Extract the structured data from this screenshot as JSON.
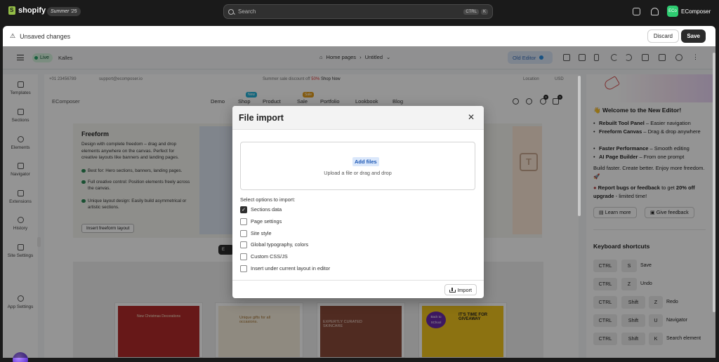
{
  "topbar": {
    "brand": "shopify",
    "edition": "Summer '25",
    "search_placeholder": "Search",
    "shortcut_keys": [
      "CTRL",
      "K"
    ],
    "account_initials": "ECo",
    "account_name": "EComposer"
  },
  "unsaved_bar": {
    "message": "Unsaved changes",
    "discard_label": "Discard",
    "save_label": "Save"
  },
  "editor_toolbar": {
    "live_label": "Live",
    "theme_name": "Kalles",
    "breadcrumb_home": "Home pages",
    "breadcrumb_page": "Untitled",
    "old_editor_label": "Old Editor"
  },
  "left_rail": {
    "items": [
      {
        "label": "Templates",
        "icon": "templates-icon"
      },
      {
        "label": "Sections",
        "icon": "sections-icon"
      },
      {
        "label": "Elements",
        "icon": "elements-icon"
      },
      {
        "label": "Navigator",
        "icon": "navigator-icon"
      },
      {
        "label": "Extensions",
        "icon": "extensions-icon"
      },
      {
        "label": "History",
        "icon": "history-icon"
      },
      {
        "label": "Site Settings",
        "icon": "site-settings-icon"
      }
    ],
    "app_settings": "App Settings"
  },
  "canvas": {
    "phone": "+01 23456789",
    "email": "support@ecomposer.io",
    "promo_prefix": "Summer sale discount off ",
    "promo_percent": "50%",
    "promo_link": "Shop Now",
    "location": "Location",
    "currency": "USD",
    "site_logo": "EComposer",
    "nav": [
      "Demo",
      "Shop",
      "Product",
      "Sale",
      "Portfolio",
      "Lookbook",
      "Blog"
    ],
    "nav_badges": {
      "shop": "New",
      "sale": "Sale"
    },
    "wishlist_count": "0",
    "cart_count": "0",
    "freeform": {
      "title": "Freeform",
      "description": "Design with complete freedom – drag and drop elements anywhere on the canvas. Perfect for creative layouts like banners and landing pages.",
      "points": [
        "Best for: Hero sections, banners, landing pages.",
        "Full creative control: Position elements freely across the canvas.",
        "Unique layout design: Easily build asymmetrical or artistic sections."
      ],
      "button": "Insert freeform layout"
    },
    "templates": [
      {
        "caption": "New Christmas Decorations",
        "bg": "#b22a2a"
      },
      {
        "caption": "Unique gifts for all occasions.",
        "bg": "#f7eedc"
      },
      {
        "caption": "EXPERTLY CURATED SKINCARE",
        "bg": "#8a4a3a"
      },
      {
        "caption": "IT'S TIME FOR GIVEAWAY",
        "bg": "#f2c41e"
      }
    ],
    "template_logo": "Back to SChool"
  },
  "right_panel": {
    "welcome": "Welcome to the New Editor!",
    "features": [
      {
        "bold": "Rebuilt Tool Panel",
        "rest": " – Easier navigation"
      },
      {
        "bold": "Freeform Canvas",
        "rest": " – Drag & drop anywhere"
      },
      {
        "bold": "Faster Performance",
        "rest": " – Smooth editing"
      },
      {
        "bold": "AI Page Builder",
        "rest": " – From one prompt"
      }
    ],
    "tagline": "Build faster. Create better. Enjoy more freedom. 🚀",
    "report_bold": "Report bugs or feedback",
    "report_mid": " to get ",
    "report_bold2": "20% off upgrade",
    "report_end": " - limited time!",
    "learn_more": "Learn more",
    "give_feedback": "Give feedback",
    "shortcuts_title": "Keyboard shortcuts",
    "shortcuts": [
      {
        "keys": [
          "CTRL",
          "S"
        ],
        "label": "Save"
      },
      {
        "keys": [
          "CTRL",
          "Z"
        ],
        "label": "Undo"
      },
      {
        "keys": [
          "CTRL",
          "Shift",
          "Z"
        ],
        "label": "Redo"
      },
      {
        "keys": [
          "CTRL",
          "Shift",
          "U"
        ],
        "label": "Navigator"
      },
      {
        "keys": [
          "CTRL",
          "Shift",
          "K"
        ],
        "label": "Search element"
      }
    ]
  },
  "modal": {
    "title": "File import",
    "add_files": "Add files",
    "drop_hint": "Upload a file or drag and drop",
    "options_label": "Select options to import:",
    "options": [
      {
        "label": "Sections data",
        "checked": true
      },
      {
        "label": "Page settings",
        "checked": false
      },
      {
        "label": "Site style",
        "checked": false
      },
      {
        "label": "Global typography, colors",
        "checked": false
      },
      {
        "label": "Custom CSS/JS",
        "checked": false
      },
      {
        "label": "Insert under current layout in editor",
        "checked": false
      }
    ],
    "import_label": "Import"
  },
  "colors": {
    "accent_green": "#29a36a",
    "save_button": "#2b2b2b",
    "add_files_blue": "#1b56b3"
  }
}
